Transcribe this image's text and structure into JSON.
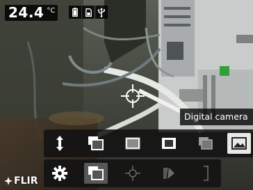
{
  "status": {
    "temperature": "24.4",
    "unit": "°C",
    "icons": [
      "battery-icon",
      "sd-card-icon",
      "usb-icon"
    ]
  },
  "tooltip": {
    "text": "Digital camera"
  },
  "toolbar_top": {
    "buttons": [
      {
        "name": "sort-arrows-icon",
        "selected": false
      },
      {
        "name": "picture-in-picture-icon",
        "selected": false
      },
      {
        "name": "thermal-mode-icon",
        "selected": false
      },
      {
        "name": "blending-mode-icon",
        "selected": false
      },
      {
        "name": "fusion-mode-icon",
        "selected": false
      },
      {
        "name": "digital-camera-icon",
        "selected": true
      }
    ]
  },
  "toolbar_bottom": {
    "buttons": [
      {
        "name": "settings-gear-icon",
        "selected": false
      },
      {
        "name": "image-mode-icon",
        "selected": true
      },
      {
        "name": "measurement-spot-icon",
        "selected": false
      },
      {
        "name": "color-palette-icon",
        "selected": false
      },
      {
        "name": "temperature-scale-icon",
        "selected": false
      }
    ]
  },
  "brand": {
    "logo_text": "FLIR"
  },
  "colors": {
    "toolbar_bg": "#121212",
    "selected_bg": "#e8e8e8",
    "text": "#ffffff"
  }
}
